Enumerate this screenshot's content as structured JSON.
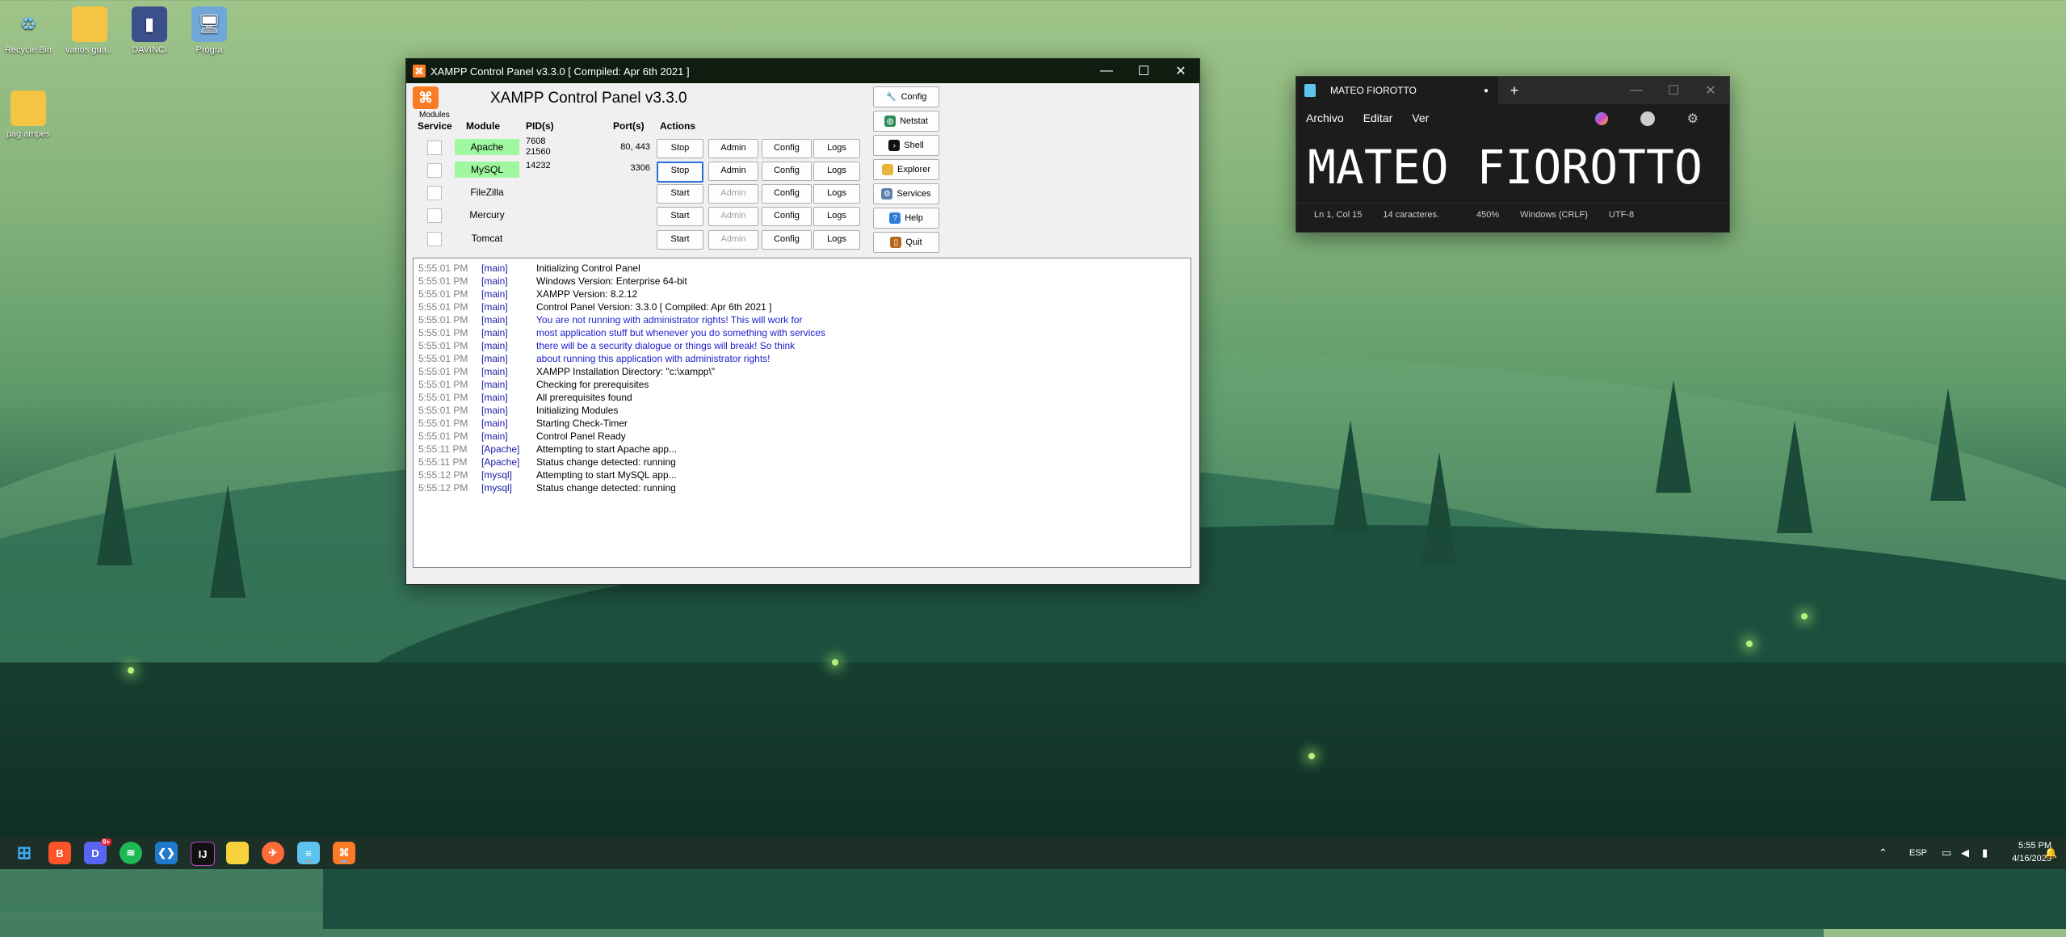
{
  "desktop": {
    "icons": [
      {
        "label": "Recycle Bin",
        "icon": "recycle-bin-icon"
      },
      {
        "label": "varios gua...",
        "icon": "folder-icon"
      },
      {
        "label": "DAVINCI",
        "icon": "davinci-icon"
      },
      {
        "label": "Progra",
        "icon": "computer-icon"
      },
      {
        "label": "pag ampes",
        "icon": "folder-icon"
      }
    ]
  },
  "xampp": {
    "window_title": "XAMPP Control Panel v3.3.0   [ Compiled: Apr 6th 2021 ]",
    "header_title": "XAMPP Control Panel v3.3.0",
    "modules_label": "Modules",
    "columns": {
      "service": "Service",
      "module": "Module",
      "pids": "PID(s)",
      "ports": "Port(s)",
      "actions": "Actions"
    },
    "modules": [
      {
        "name": "Apache",
        "pids": "7608\n21560",
        "ports": "80, 443",
        "action": "Stop",
        "admin": "Admin",
        "config": "Config",
        "logs": "Logs",
        "running": true
      },
      {
        "name": "MySQL",
        "pids": "14232",
        "ports": "3306",
        "action": "Stop",
        "admin": "Admin",
        "config": "Config",
        "logs": "Logs",
        "running": true
      },
      {
        "name": "FileZilla",
        "pids": "",
        "ports": "",
        "action": "Start",
        "admin": "Admin",
        "config": "Config",
        "logs": "Logs",
        "running": false
      },
      {
        "name": "Mercury",
        "pids": "",
        "ports": "",
        "action": "Start",
        "admin": "Admin",
        "config": "Config",
        "logs": "Logs",
        "running": false
      },
      {
        "name": "Tomcat",
        "pids": "",
        "ports": "",
        "action": "Start",
        "admin": "Admin",
        "config": "Config",
        "logs": "Logs",
        "running": false
      }
    ],
    "side_buttons": [
      "Config",
      "Netstat",
      "Shell",
      "Explorer",
      "Services",
      "Help",
      "Quit"
    ],
    "log": [
      {
        "time": "5:55:01 PM",
        "module": "[main]",
        "msg": "Initializing Control Panel",
        "warn": false
      },
      {
        "time": "5:55:01 PM",
        "module": "[main]",
        "msg": "Windows Version:  Enterprise  64-bit",
        "warn": false
      },
      {
        "time": "5:55:01 PM",
        "module": "[main]",
        "msg": "XAMPP Version: 8.2.12",
        "warn": false
      },
      {
        "time": "5:55:01 PM",
        "module": "[main]",
        "msg": "Control Panel Version: 3.3.0  [ Compiled: Apr 6th 2021 ]",
        "warn": false
      },
      {
        "time": "5:55:01 PM",
        "module": "[main]",
        "msg": "You are not running with administrator rights! This will work for",
        "warn": true
      },
      {
        "time": "5:55:01 PM",
        "module": "[main]",
        "msg": "most application stuff but whenever you do something with services",
        "warn": true
      },
      {
        "time": "5:55:01 PM",
        "module": "[main]",
        "msg": "there will be a security dialogue or things will break! So think",
        "warn": true
      },
      {
        "time": "5:55:01 PM",
        "module": "[main]",
        "msg": "about running this application with administrator rights!",
        "warn": true
      },
      {
        "time": "5:55:01 PM",
        "module": "[main]",
        "msg": "XAMPP Installation Directory: \"c:\\xampp\\\"",
        "warn": false
      },
      {
        "time": "5:55:01 PM",
        "module": "[main]",
        "msg": "Checking for prerequisites",
        "warn": false
      },
      {
        "time": "5:55:01 PM",
        "module": "[main]",
        "msg": "All prerequisites found",
        "warn": false
      },
      {
        "time": "5:55:01 PM",
        "module": "[main]",
        "msg": "Initializing Modules",
        "warn": false
      },
      {
        "time": "5:55:01 PM",
        "module": "[main]",
        "msg": "Starting Check-Timer",
        "warn": false
      },
      {
        "time": "5:55:01 PM",
        "module": "[main]",
        "msg": "Control Panel Ready",
        "warn": false
      },
      {
        "time": "5:55:11 PM",
        "module": "[Apache]",
        "msg": "Attempting to start Apache app...",
        "warn": false
      },
      {
        "time": "5:55:11 PM",
        "module": "[Apache]",
        "msg": "Status change detected: running",
        "warn": false
      },
      {
        "time": "5:55:12 PM",
        "module": "[mysql]",
        "msg": "Attempting to start MySQL app...",
        "warn": false
      },
      {
        "time": "5:55:12 PM",
        "module": "[mysql]",
        "msg": "Status change detected: running",
        "warn": false
      }
    ]
  },
  "notepad": {
    "tab_title": "MATEO FIOROTTO",
    "menu": [
      "Archivo",
      "Editar",
      "Ver"
    ],
    "content": "MATEO FIOROTTO",
    "status": {
      "position": "Ln 1, Col 15",
      "chars": "14 caracteres.",
      "zoom": "450%",
      "eol": "Windows (CRLF)",
      "encoding": "UTF-8"
    }
  },
  "taskbar": {
    "apps": [
      "windows-start-icon",
      "brave-icon",
      "discord-icon",
      "spotify-icon",
      "vscode-icon",
      "jetbrains-icon",
      "sticky-notes-icon",
      "postman-icon",
      "notepad-icon",
      "xampp-icon"
    ],
    "discord_badge": "9+",
    "language": "ESP",
    "time": "5:55 PM",
    "date": "4/16/2025"
  }
}
